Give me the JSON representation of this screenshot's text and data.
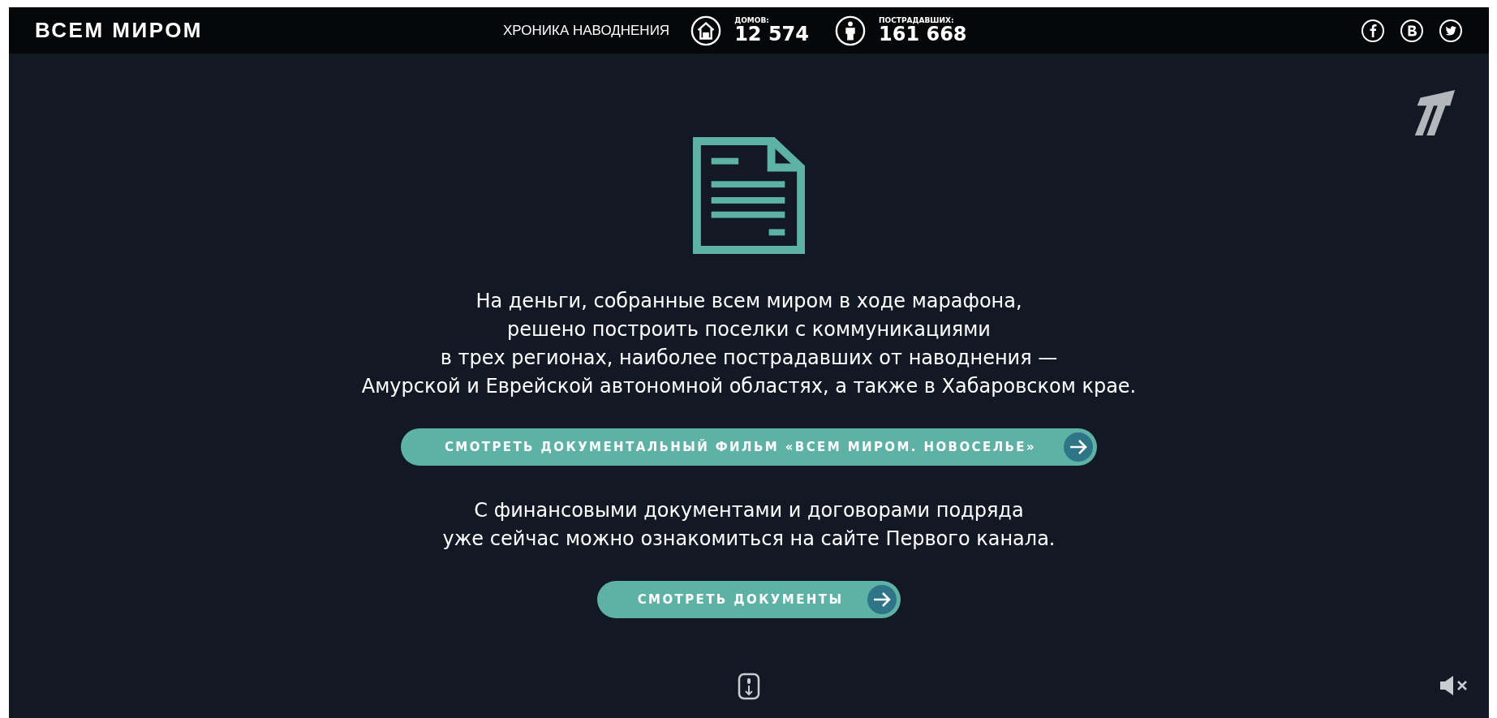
{
  "header": {
    "logo": "ВСЕМ МИРОМ",
    "nav_link": "ХРОНИКА НАВОДНЕНИЯ",
    "stats": [
      {
        "kind": "houses",
        "label": "ДОМОВ:",
        "value": "12 574"
      },
      {
        "kind": "victims",
        "label": "ПОСТРАДАВШИХ:",
        "value": "161 668"
      }
    ],
    "social": [
      {
        "kind": "facebook"
      },
      {
        "kind": "vk"
      },
      {
        "kind": "twitter"
      }
    ]
  },
  "main": {
    "paragraphs": [
      [
        "На деньги, собранные всем миром в ходе марафона,",
        "решено построить поселки с коммуникациями",
        "в трех регионах, наиболее пострадавших от наводнения —",
        "Амурской и Еврейской автономной областях, а также в Хабаровском крае."
      ],
      [
        "С финансовыми документами и договорами подряда",
        "уже сейчас можно ознакомиться на сайте Первого канала."
      ]
    ],
    "buttons": [
      "СМОТРЕТЬ ДОКУМЕНТАЛЬНЫЙ ФИЛЬМ «ВСЕМ МИРОМ. НОВОСЕЛЬЕ»",
      "СМОТРЕТЬ ДОКУМЕНТЫ"
    ]
  },
  "sound": {
    "muted": true
  }
}
